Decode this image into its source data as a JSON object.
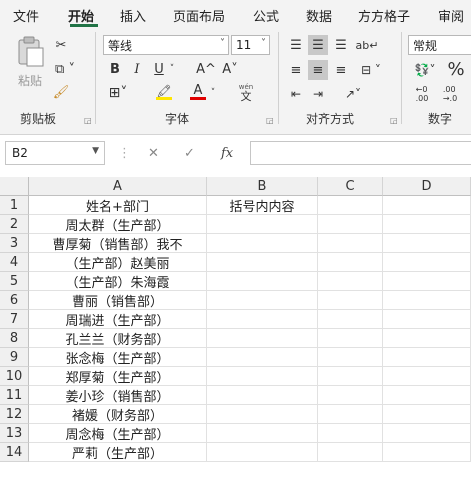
{
  "tabs": [
    "文件",
    "开始",
    "插入",
    "页面布局",
    "公式",
    "数据",
    "方方格子",
    "审阅"
  ],
  "active_tab": "开始",
  "clipboard": {
    "paste_label": "粘贴",
    "group_label": "剪贴板"
  },
  "font": {
    "name": "等线",
    "size": "11",
    "group_label": "字体",
    "bold": "B",
    "italic": "I",
    "underline": "U",
    "grow": "A^",
    "shrink": "A˅",
    "phonetic_top": "wén",
    "phonetic_bottom": "文",
    "highlight_color": "#ffe600",
    "font_color": "#e00000"
  },
  "alignment": {
    "group_label": "对齐方式"
  },
  "number": {
    "format": "常规",
    "group_label": "数字",
    "percent": "%"
  },
  "formula_bar": {
    "name_box": "B2",
    "fx": "fx",
    "value": ""
  },
  "columns": [
    "A",
    "B",
    "C",
    "D"
  ],
  "rows": [
    {
      "n": "1",
      "A": "姓名+部门",
      "B": "括号内内容"
    },
    {
      "n": "2",
      "A": "周太群（生产部）",
      "B": ""
    },
    {
      "n": "3",
      "A": "曹厚菊（销售部）我不",
      "B": ""
    },
    {
      "n": "4",
      "A": "（生产部）赵美丽",
      "B": ""
    },
    {
      "n": "5",
      "A": "（生产部）朱海霞",
      "B": ""
    },
    {
      "n": "6",
      "A": "曹丽（销售部）",
      "B": ""
    },
    {
      "n": "7",
      "A": "周瑞进（生产部）",
      "B": ""
    },
    {
      "n": "8",
      "A": "孔兰兰（财务部）",
      "B": ""
    },
    {
      "n": "9",
      "A": "张念梅（生产部）",
      "B": ""
    },
    {
      "n": "10",
      "A": "郑厚菊（生产部）",
      "B": ""
    },
    {
      "n": "11",
      "A": "姜小珍（销售部）",
      "B": ""
    },
    {
      "n": "12",
      "A": "褚媛（财务部）",
      "B": ""
    },
    {
      "n": "13",
      "A": "周念梅（生产部）",
      "B": ""
    },
    {
      "n": "14",
      "A": "严莉（生产部）",
      "B": ""
    }
  ]
}
